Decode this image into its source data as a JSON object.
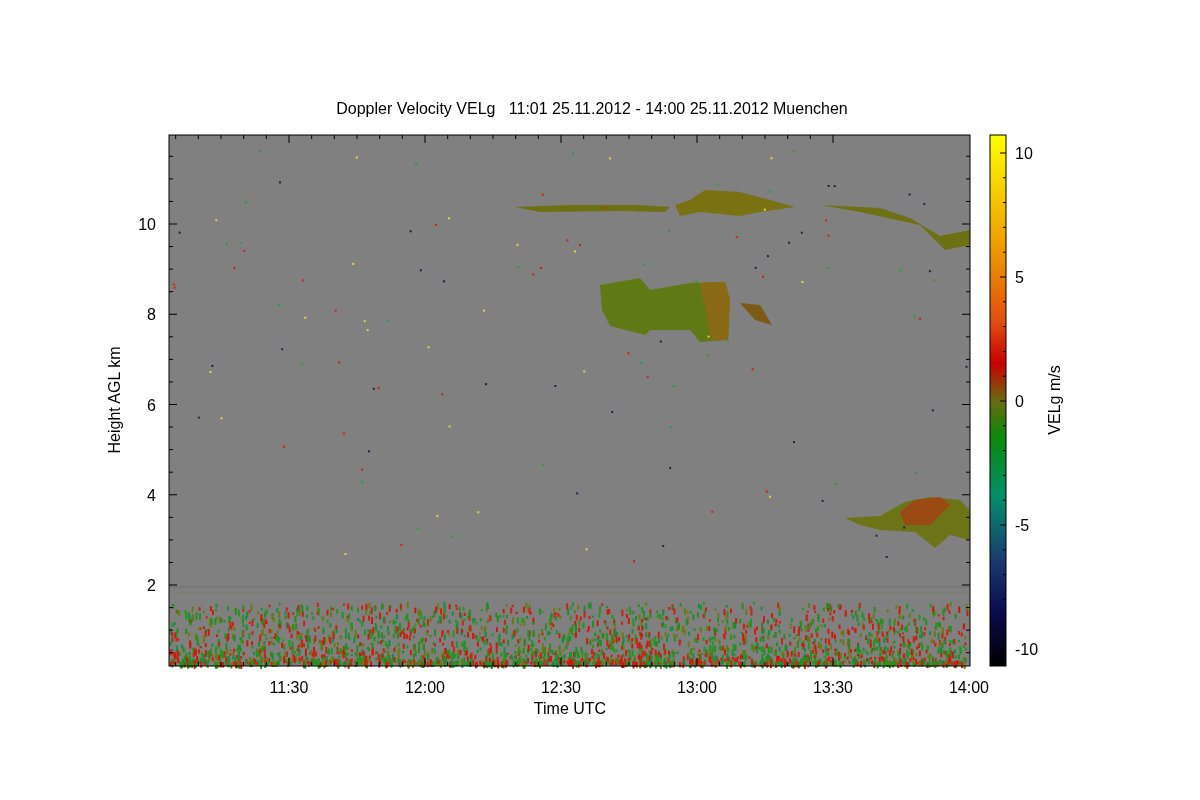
{
  "title": "Doppler Velocity VELg   11:01 25.11.2012 - 14:00 25.11.2012 Muenchen",
  "y_axis": {
    "label": "Height AGL km",
    "ticks": [
      "10",
      "8",
      "6",
      "4",
      "2"
    ]
  },
  "x_axis": {
    "label": "Time UTC",
    "ticks": [
      "11:30",
      "12:00",
      "12:30",
      "13:00",
      "13:30",
      "14:00"
    ]
  },
  "colorbar": {
    "label": "VELg m/s",
    "ticks": [
      "10",
      "5",
      "0",
      "-5",
      "-10"
    ]
  }
}
